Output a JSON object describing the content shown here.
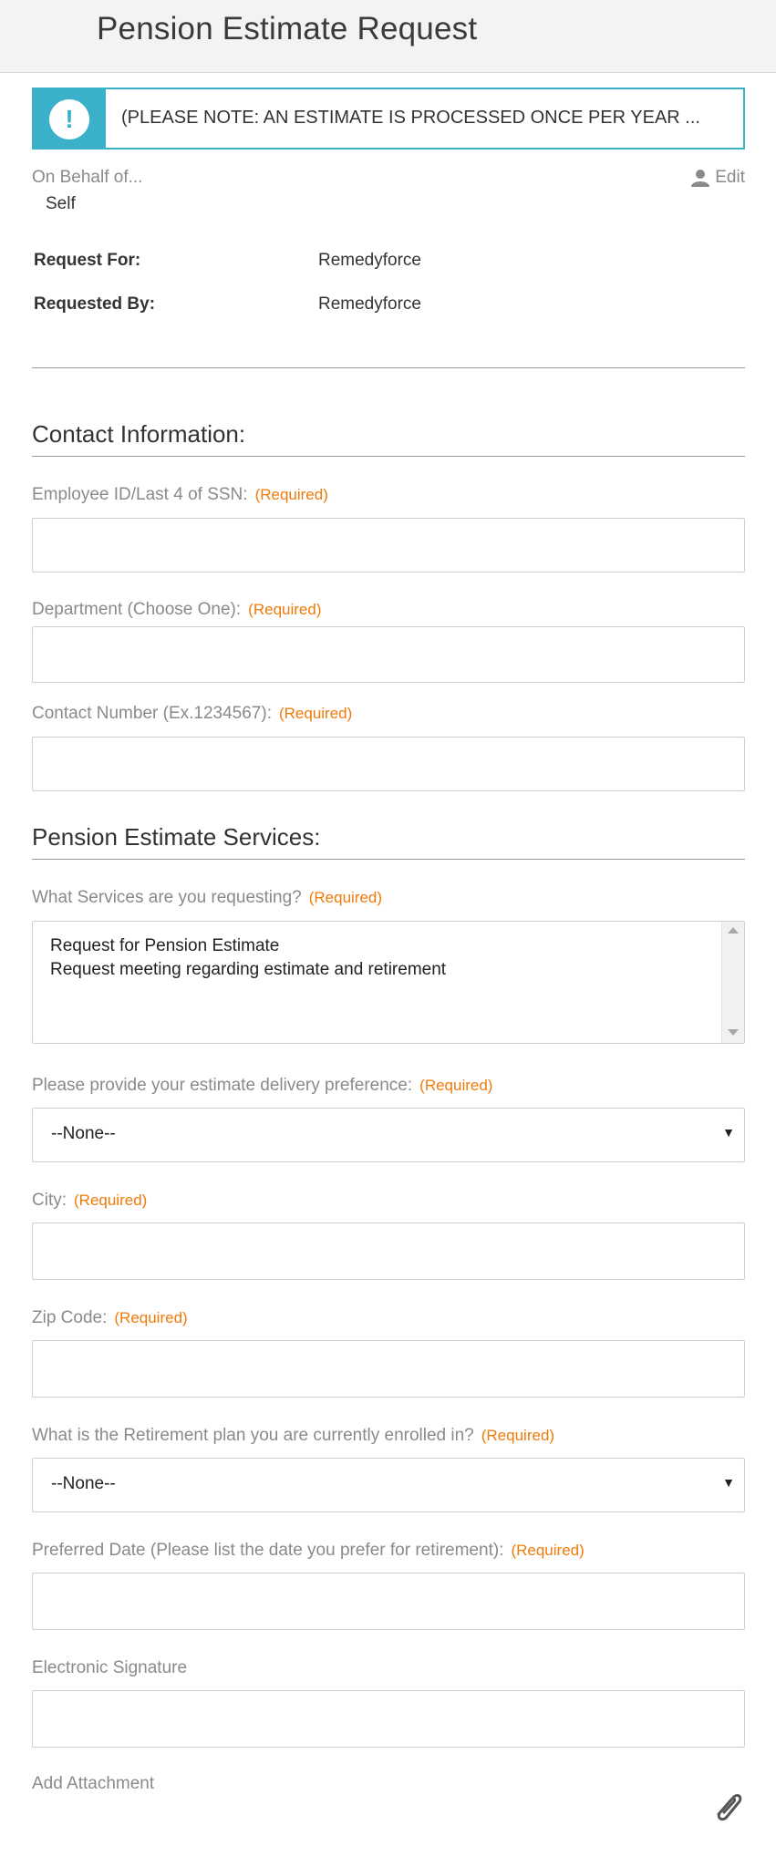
{
  "header": {
    "title": "Pension Estimate Request"
  },
  "notice": {
    "icon": "exclamation-icon",
    "text": "(PLEASE NOTE: AN ESTIMATE IS PROCESSED ONCE PER YEAR ..."
  },
  "behalf": {
    "label": "On Behalf of...",
    "value": "Self",
    "edit_label": "Edit",
    "edit_icon": "user-icon"
  },
  "request_for": {
    "label": "Request For:",
    "value": "Remedyforce"
  },
  "requested_by": {
    "label": "Requested By:",
    "value": "Remedyforce"
  },
  "required_text": "(Required)",
  "contact": {
    "title": "Contact Information:",
    "employee_id": {
      "label": "Employee ID/Last 4 of SSN:",
      "value": ""
    },
    "department": {
      "label": "Department (Choose One):",
      "value": ""
    },
    "contact_number": {
      "label": "Contact Number (Ex.1234567):",
      "value": ""
    }
  },
  "services": {
    "title": "Pension Estimate Services:",
    "requested": {
      "label": "What Services are you requesting?",
      "options": [
        "Request for Pension Estimate",
        "Request meeting regarding estimate and retirement"
      ]
    },
    "delivery": {
      "label": "Please provide your estimate delivery preference:",
      "selected": "--None--"
    },
    "city": {
      "label": "City:",
      "value": ""
    },
    "zip": {
      "label": "Zip Code:",
      "value": ""
    },
    "plan": {
      "label": "What is the Retirement plan you are currently enrolled in?",
      "selected": "--None--"
    },
    "preferred_date": {
      "label": "Preferred Date (Please list the date you prefer for retirement):",
      "value": ""
    },
    "signature": {
      "label": "Electronic Signature",
      "value": ""
    },
    "attachment": {
      "label": "Add Attachment",
      "icon": "paperclip-icon"
    }
  },
  "colors": {
    "accent": "#3bb0c9",
    "required": "#f07a0a",
    "label": "#8a8a8a"
  }
}
